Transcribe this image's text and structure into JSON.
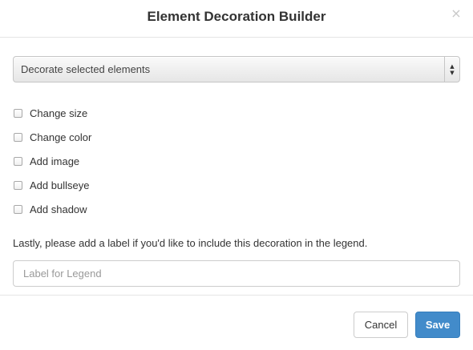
{
  "dialog": {
    "title": "Element Decoration Builder",
    "close_glyph": "×"
  },
  "target_select": {
    "selected": "Decorate selected elements",
    "arrow_up": "▲",
    "arrow_down": "▼"
  },
  "options": [
    {
      "label": "Change size",
      "checked": false
    },
    {
      "label": "Change color",
      "checked": false
    },
    {
      "label": "Add image",
      "checked": false
    },
    {
      "label": "Add bullseye",
      "checked": false
    },
    {
      "label": "Add shadow",
      "checked": false
    }
  ],
  "legend": {
    "hint": "Lastly, please add a label if you'd like to include this decoration in the legend.",
    "placeholder": "Label for Legend",
    "value": ""
  },
  "footer": {
    "cancel_label": "Cancel",
    "save_label": "Save"
  },
  "colors": {
    "primary": "#428bca",
    "border": "#e5e5e5"
  }
}
